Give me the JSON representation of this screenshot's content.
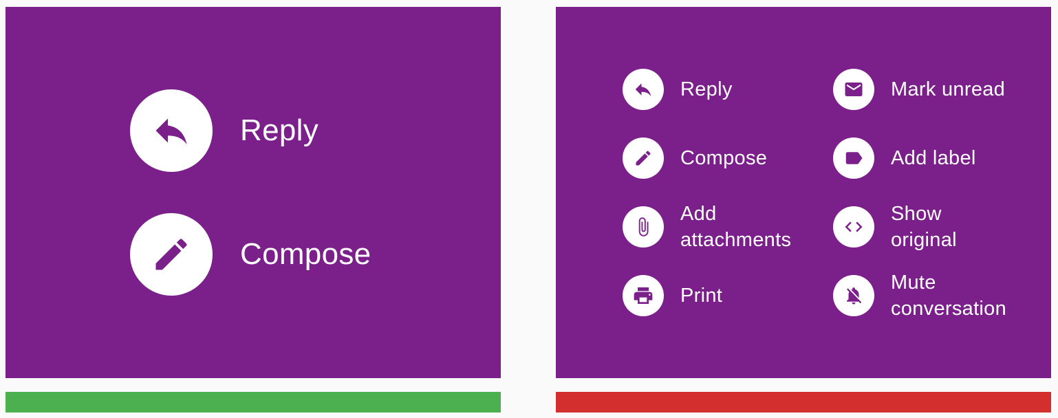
{
  "colors": {
    "panel_bg": "#7b1f8a",
    "icon_circle": "#ffffff",
    "icon_glyph": "#7b1f8a",
    "text": "#ffffff",
    "good_bar": "#4caf50",
    "bad_bar": "#d32f2f"
  },
  "left_panel": {
    "actions": [
      {
        "label": "Reply",
        "icon": "reply-icon"
      },
      {
        "label": "Compose",
        "icon": "pencil-icon"
      }
    ]
  },
  "right_panel": {
    "actions": [
      {
        "label": "Reply",
        "icon": "reply-icon"
      },
      {
        "label": "Mark unread",
        "icon": "envelope-icon"
      },
      {
        "label": "Compose",
        "icon": "pencil-icon"
      },
      {
        "label": "Add label",
        "icon": "label-tag-icon"
      },
      {
        "label": "Add\nattachments",
        "icon": "paperclip-icon"
      },
      {
        "label": "Show\noriginal",
        "icon": "code-brackets-icon"
      },
      {
        "label": "Print",
        "icon": "printer-icon"
      },
      {
        "label": "Mute\nconversation",
        "icon": "bell-off-icon"
      }
    ]
  }
}
